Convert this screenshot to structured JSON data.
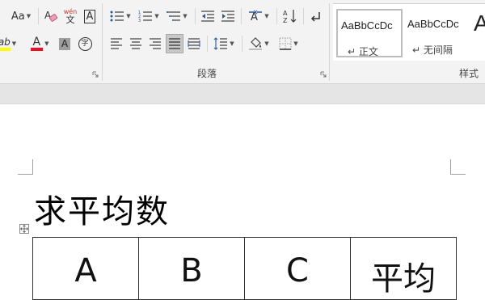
{
  "ribbon": {
    "font": {
      "change_case_label": "Aa",
      "phonetic_top": "wén",
      "phonetic_bottom": "文",
      "char_border_label": "A",
      "highlight_label": "ab",
      "font_color_label": "A",
      "char_shading_label": "A",
      "enclose_char_label": "字"
    },
    "paragraph": {
      "group_label": "段落"
    },
    "styles": {
      "group_label": "样式",
      "items": [
        {
          "sample": "AaBbCcDc",
          "name": "↵ 正文"
        },
        {
          "sample": "AaBbCcDc",
          "name": "↵ 无间隔"
        },
        {
          "sample": "A"
        }
      ]
    },
    "colors": {
      "highlight": "#ffff00",
      "font_color": "#e81123",
      "ribbon_bg": "#f3f3f3"
    }
  },
  "document": {
    "title": "求平均数",
    "table": {
      "headers": [
        "A",
        "B",
        "C",
        "平均"
      ]
    }
  }
}
